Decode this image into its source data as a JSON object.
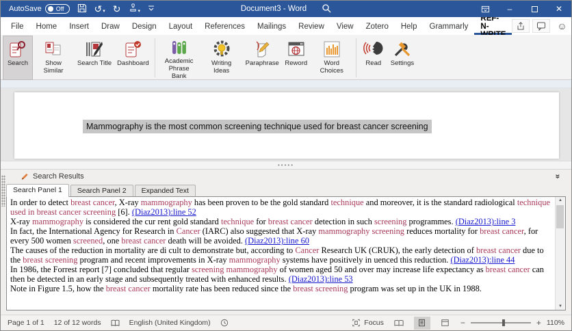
{
  "colors": {
    "titlebar": "#2b579a",
    "accent": "#2b579a",
    "keyword": "#a83a5a",
    "link": "#1515cd"
  },
  "icons": {
    "undo": "↺",
    "redo": "↻",
    "dropdown": "▾",
    "close": "✕",
    "minimize": "–",
    "collapse_panel": "»",
    "smiley": "☺",
    "scroll_up": "▲",
    "scroll_down": "▼",
    "zoom_out": "−",
    "zoom_in": "+"
  },
  "titlebar": {
    "autosave_label": "AutoSave",
    "autosave_state": "Off",
    "title": "Document3  -  Word"
  },
  "menubar": {
    "items": [
      "File",
      "Home",
      "Insert",
      "Draw",
      "Design",
      "Layout",
      "References",
      "Mailings",
      "Review",
      "View",
      "Zotero",
      "Help",
      "Grammarly",
      "REF-N-WRITE"
    ],
    "active_index": 13
  },
  "ribbon": {
    "buttons": [
      {
        "label": "Search"
      },
      {
        "label": "Show Similar"
      },
      {
        "label": "Search Title"
      },
      {
        "label": "Dashboard"
      },
      {
        "label": "Academic Phrase Bank"
      },
      {
        "label": "Writing Ideas"
      },
      {
        "label": "Paraphrase"
      },
      {
        "label": "Reword"
      },
      {
        "label": "Word Choices"
      },
      {
        "label": "Read"
      },
      {
        "label": "Settings"
      }
    ]
  },
  "document": {
    "sentence": "Mammography is the most common screening technique used for breast cancer screening"
  },
  "panel": {
    "title": "Search Results",
    "tabs": [
      {
        "label": "Search Panel 1",
        "active": true
      },
      {
        "label": "Search Panel 2",
        "active": false
      },
      {
        "label": "Expanded Text",
        "active": false
      }
    ],
    "results": [
      [
        {
          "s": "n",
          "t": "In order to detect "
        },
        {
          "s": "k",
          "t": "breast cancer"
        },
        {
          "s": "n",
          "t": ", X-ray "
        },
        {
          "s": "k",
          "t": "mammography"
        },
        {
          "s": "n",
          "t": " has been proven to be the gold standard "
        },
        {
          "s": "k",
          "t": "technique"
        },
        {
          "s": "n",
          "t": " and moreover, it is the standard radiological "
        },
        {
          "s": "k",
          "t": "technique used in"
        },
        {
          "s": "n",
          "t": " "
        },
        {
          "s": "k",
          "t": "breast cancer screening"
        },
        {
          "s": "n",
          "t": " [6]. "
        },
        {
          "s": "l",
          "t": "(Diaz2013):line 52"
        }
      ],
      [
        {
          "s": "n",
          "t": "X-ray "
        },
        {
          "s": "k",
          "t": "mammography"
        },
        {
          "s": "n",
          "t": " is considered the cur rent gold standard "
        },
        {
          "s": "k",
          "t": "technique"
        },
        {
          "s": "n",
          "t": " for "
        },
        {
          "s": "k",
          "t": "breast cancer"
        },
        {
          "s": "n",
          "t": " detection in such "
        },
        {
          "s": "k",
          "t": "screening"
        },
        {
          "s": "n",
          "t": " programmes. "
        },
        {
          "s": "l",
          "t": "(Diaz2013):line 3"
        }
      ],
      [
        {
          "s": "n",
          "t": "In fact, the International Agency for Research in "
        },
        {
          "s": "k",
          "t": "Cancer"
        },
        {
          "s": "n",
          "t": " (IARC) also suggested that X-ray "
        },
        {
          "s": "k",
          "t": "mammography screening"
        },
        {
          "s": "n",
          "t": " reduces mortality for "
        },
        {
          "s": "k",
          "t": "breast cancer"
        },
        {
          "s": "n",
          "t": ", for every 500 women "
        },
        {
          "s": "k",
          "t": "screened"
        },
        {
          "s": "n",
          "t": ", one "
        },
        {
          "s": "k",
          "t": "breast cancer"
        },
        {
          "s": "n",
          "t": " death will be avoided. "
        },
        {
          "s": "l",
          "t": "(Diaz2013):line 60"
        }
      ],
      [
        {
          "s": "n",
          "t": "The causes of the reduction in mortality are di cult to demonstrate but, according to "
        },
        {
          "s": "k",
          "t": "Cancer"
        },
        {
          "s": "n",
          "t": " Research UK (CRUK), the early detection of "
        },
        {
          "s": "k",
          "t": "breast cancer"
        },
        {
          "s": "n",
          "t": " due to the "
        },
        {
          "s": "k",
          "t": "breast screening"
        },
        {
          "s": "n",
          "t": " program and recent improvements in X-ray "
        },
        {
          "s": "k",
          "t": "mammography"
        },
        {
          "s": "n",
          "t": " systems have positively in uenced this reduction. "
        },
        {
          "s": "l",
          "t": "(Diaz2013):line 44"
        }
      ],
      [
        {
          "s": "n",
          "t": "In 1986, the Forrest report [7] concluded that regular "
        },
        {
          "s": "k",
          "t": "screening mammography"
        },
        {
          "s": "n",
          "t": " of women aged 50 and over may increase life expectancy as "
        },
        {
          "s": "k",
          "t": "breast cancer"
        },
        {
          "s": "n",
          "t": " can then be detected in an early stage and subsequently treated with enhanced results. "
        },
        {
          "s": "l",
          "t": "(Diaz2013):line 53"
        }
      ],
      [
        {
          "s": "n",
          "t": "Note in Figure 1.5, how the "
        },
        {
          "s": "k",
          "t": "breast cancer"
        },
        {
          "s": "n",
          "t": " mortality rate has been reduced since the "
        },
        {
          "s": "k",
          "t": "breast screening"
        },
        {
          "s": "n",
          "t": " program was set up in the UK in 1988."
        }
      ]
    ]
  },
  "statusbar": {
    "page": "Page 1 of 1",
    "words": "12 of 12 words",
    "language": "English (United Kingdom)",
    "focus": "Focus",
    "zoom": "110%"
  }
}
